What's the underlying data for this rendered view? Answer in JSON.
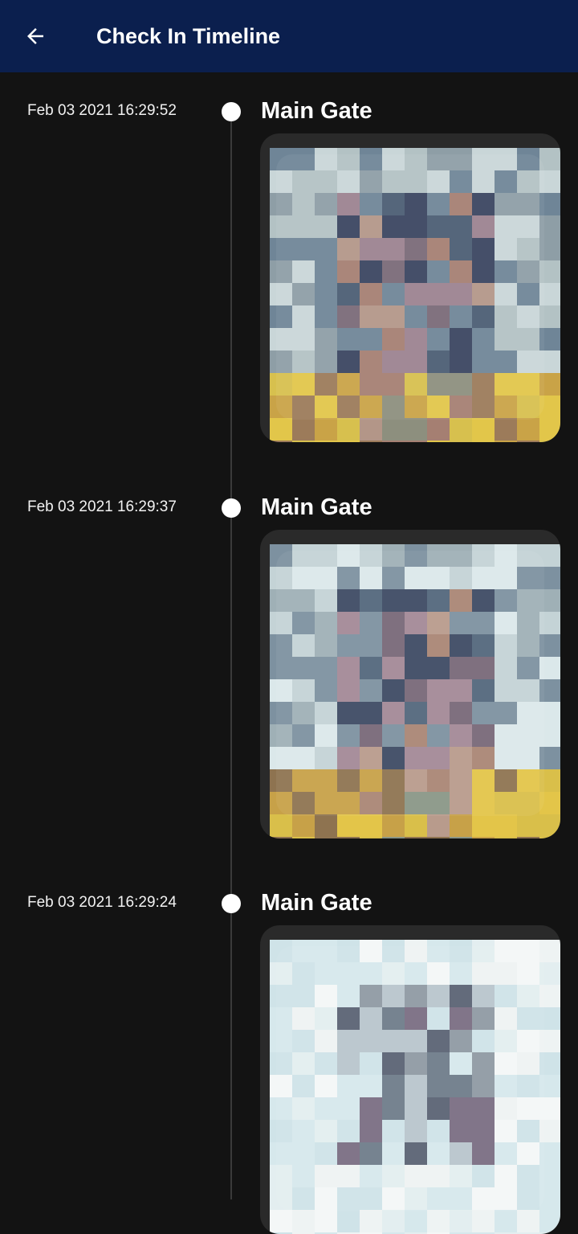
{
  "header": {
    "title": "Check In Timeline",
    "back_icon": "arrow-left-icon",
    "background_color": "#0b1f4e"
  },
  "timeline": {
    "entries": [
      {
        "timestamp": "Feb 03 2021 16:29:52",
        "location": "Main Gate",
        "photo_icon": "pixelated-face-photo"
      },
      {
        "timestamp": "Feb 03 2021 16:29:37",
        "location": "Main Gate",
        "photo_icon": "pixelated-face-photo"
      },
      {
        "timestamp": "Feb 03 2021 16:29:24",
        "location": "Main Gate",
        "photo_icon": "pixelated-face-photo"
      }
    ]
  }
}
